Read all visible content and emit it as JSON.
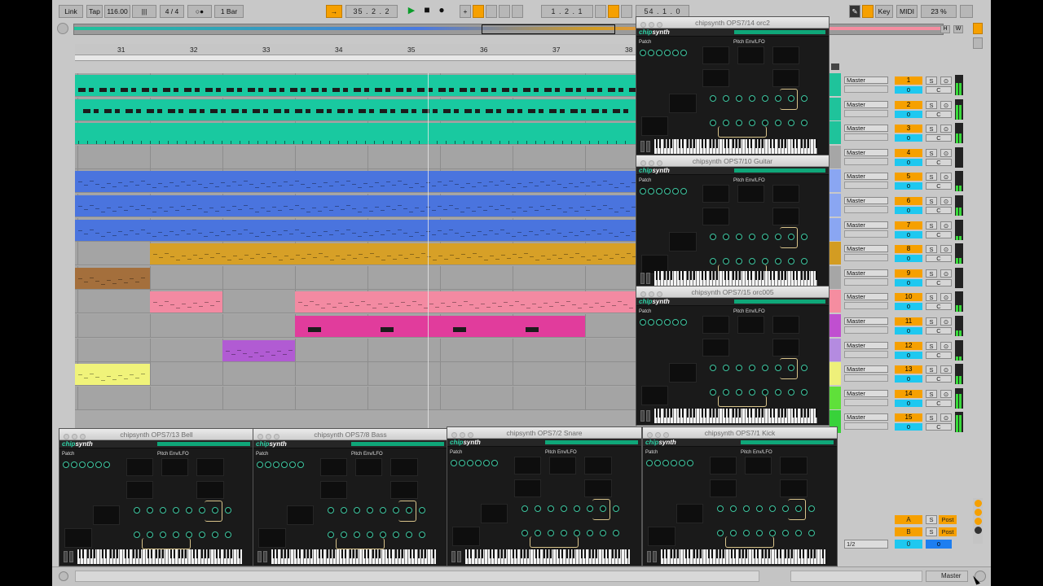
{
  "toolbar": {
    "link": "Link",
    "tap": "Tap",
    "tempo": "116.00",
    "meter_icon": "|||",
    "signature": "4 / 4",
    "metronome": "○●",
    "quantize": "1 Bar",
    "follow_icon": "→",
    "position": "35 .  2 .  2",
    "play_icon": "▶",
    "stop_icon": "■",
    "record_icon": "●",
    "plus_icon": "+",
    "loop_start": "1 .  2 .  1",
    "loop_length": "54 .  1 .  0",
    "key": "Key",
    "midi": "MIDI",
    "cpu": "23 %",
    "pencil_icon": "pencil-icon"
  },
  "overview": {
    "h": "H",
    "w": "W"
  },
  "ruler": {
    "bars": [
      "31",
      "32",
      "33",
      "34",
      "35",
      "36",
      "37",
      "38"
    ]
  },
  "tracks": [
    {
      "color": "#1fc39b",
      "clips": [
        {
          "color": "#19c9a0",
          "start": 0,
          "end": 690
        }
      ],
      "pattern": "dense"
    },
    {
      "color": "#1fc39b",
      "clips": [
        {
          "color": "#19c9a0",
          "start": 0,
          "end": 690
        }
      ],
      "pattern": "dense2"
    },
    {
      "color": "#1fc39b",
      "clips": [
        {
          "color": "#19c9a0",
          "start": 0,
          "end": 690
        }
      ],
      "pattern": "thin"
    },
    {
      "color": "#a6a6a6",
      "clips": [],
      "pattern": ""
    },
    {
      "color": "#4a79e0",
      "clips": [
        {
          "color": "#4a74de",
          "start": 0,
          "end": 690
        }
      ],
      "pattern": "line"
    },
    {
      "color": "#4a79e0",
      "clips": [
        {
          "color": "#4a74de",
          "start": 0,
          "end": 690
        }
      ],
      "pattern": "line"
    },
    {
      "color": "#4a79e0",
      "clips": [
        {
          "color": "#4a74de",
          "start": 0,
          "end": 690
        }
      ],
      "pattern": "line"
    },
    {
      "color": "#d39c22",
      "clips": [
        {
          "color": "#d7a027",
          "start": 92,
          "end": 690
        }
      ],
      "pattern": "line"
    },
    {
      "color": "#9c6a36",
      "clips": [
        {
          "color": "#a46f3c",
          "start": 0,
          "end": 92
        }
      ],
      "pattern": "line"
    },
    {
      "color": "#f58da0",
      "clips": [
        {
          "color": "#f38aa2",
          "start": 92,
          "end": 181
        },
        {
          "color": "#f38aa2",
          "start": 270,
          "end": 690
        }
      ],
      "pattern": "line"
    },
    {
      "color": "#e23a9e",
      "clips": [
        {
          "color": "#e13c9c",
          "start": 270,
          "end": 626
        }
      ],
      "pattern": "blocks"
    },
    {
      "color": "#b25bd8",
      "clips": [
        {
          "color": "#b15bd3",
          "start": 181,
          "end": 270
        }
      ],
      "pattern": "line"
    },
    {
      "color": "#f3f57a",
      "clips": [
        {
          "color": "#f0f37a",
          "start": 0,
          "end": 92
        }
      ],
      "pattern": "line"
    },
    {
      "color": "#a6a6a6",
      "clips": [],
      "pattern": ""
    }
  ],
  "mixer": {
    "routing": "Master",
    "rows": [
      {
        "num": "1",
        "vol": "0",
        "color": "#1fc39b",
        "s": "S",
        "c": "C"
      },
      {
        "num": "2",
        "vol": "0",
        "color": "#1fc39b",
        "s": "S",
        "c": "C"
      },
      {
        "num": "3",
        "vol": "0",
        "color": "#1fc39b",
        "s": "S",
        "c": "C"
      },
      {
        "num": "4",
        "vol": "0",
        "color": "#a6a6a6",
        "s": "S",
        "c": "C"
      },
      {
        "num": "5",
        "vol": "0",
        "color": "#8aa6f2",
        "s": "S",
        "c": "C"
      },
      {
        "num": "6",
        "vol": "0",
        "color": "#8aa6f2",
        "s": "S",
        "c": "C"
      },
      {
        "num": "7",
        "vol": "0",
        "color": "#8aa6f2",
        "s": "S",
        "c": "C"
      },
      {
        "num": "8",
        "vol": "0",
        "color": "#d39c22",
        "s": "S",
        "c": "C"
      },
      {
        "num": "9",
        "vol": "0",
        "color": "#a6a6a6",
        "s": "S",
        "c": "C"
      },
      {
        "num": "10",
        "vol": "0",
        "color": "#f58da0",
        "s": "S",
        "c": "C"
      },
      {
        "num": "11",
        "vol": "0",
        "color": "#c04fd0",
        "s": "S",
        "c": "C"
      },
      {
        "num": "12",
        "vol": "0",
        "color": "#b48be0",
        "s": "S",
        "c": "C"
      },
      {
        "num": "13",
        "vol": "0",
        "color": "#eef07a",
        "s": "S",
        "c": "C"
      },
      {
        "num": "14",
        "vol": "0",
        "color": "#5fe03a",
        "s": "S",
        "c": "C"
      },
      {
        "num": "15",
        "vol": "0",
        "color": "#38d23a",
        "s": "S",
        "c": "C"
      }
    ],
    "returns": [
      {
        "name": "A",
        "vol": "0",
        "s": "S",
        "post": "Post",
        "color": "#1ec8f0"
      },
      {
        "name": "B",
        "vol": "0",
        "s": "S",
        "post": "Post",
        "color": "#1ec8f0"
      }
    ],
    "master": {
      "routing": "1/2",
      "vol": "0",
      "s": "0"
    }
  },
  "plugins": [
    {
      "title": "chipsynth OPS7/14 orc2"
    },
    {
      "title": "chipsynth OPS7/10 Guitar"
    },
    {
      "title": "chipsynth OPS7/15 orc005"
    },
    {
      "title": "chipsynth OPS7/13 Bell"
    },
    {
      "title": "chipsynth OPS7/8 Bass"
    },
    {
      "title": "chipsynth OPS7/2 Snare"
    },
    {
      "title": "chipsynth OPS7/1 Kick"
    }
  ],
  "plugin_ui": {
    "logo_a": "chip",
    "logo_b": "synth",
    "patch": "Patch",
    "pitch": "Pitch Env/LFO"
  },
  "bottom": {
    "master": "Master"
  }
}
